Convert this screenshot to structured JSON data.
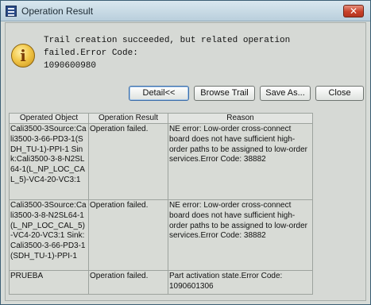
{
  "window": {
    "title": "Operation Result",
    "close_glyph": "✕"
  },
  "message": {
    "icon": "info-icon",
    "text": "Trail creation succeeded, but related operation failed.Error Code:\n1090600980"
  },
  "buttons": {
    "detail": "Detail<<",
    "browse_trail": "Browse Trail",
    "save_as": "Save As...",
    "close": "Close"
  },
  "table": {
    "columns": [
      "Operated Object",
      "Operation Result",
      "Reason"
    ],
    "rows": [
      {
        "object": "Cali3500-3Source:Cali3500-3-66-PD3-1(SDH_TU-1)-PPI-1 Sink:Cali3500-3-8-N2SL64-1(L_NP_LOC_CAL_5)-VC4-20-VC3:1",
        "result": "Operation failed.",
        "reason": "NE error: Low-order cross-connect board does not have sufficient high-order paths to be assigned to low-order services.Error Code: 38882"
      },
      {
        "object": "Cali3500-3Source:Cali3500-3-8-N2SL64-1(L_NP_LOC_CAL_5)-VC4-20-VC3:1 Sink:Cali3500-3-66-PD3-1(SDH_TU-1)-PPI-1",
        "result": "Operation failed.",
        "reason": "NE error: Low-order cross-connect board does not have sufficient high-order paths to be assigned to low-order services.Error Code: 38882"
      },
      {
        "object": "PRUEBA",
        "result": "Operation failed.",
        "reason": "Part activation state.Error Code: 1090601306"
      }
    ]
  }
}
